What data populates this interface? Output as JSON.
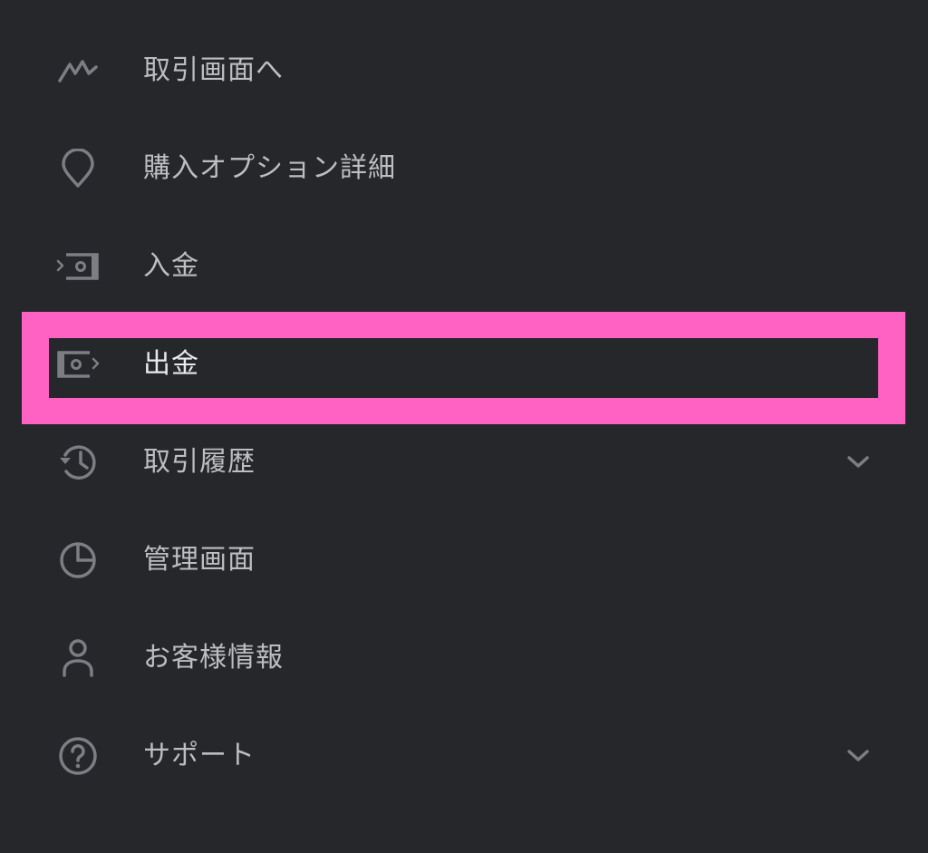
{
  "accent": {
    "highlight_color": "#ff62c2",
    "text_color": "#bdbec2",
    "icon_color": "#7d7e83",
    "background": "#26272b"
  },
  "menu": {
    "items": [
      {
        "label": "取引画面へ",
        "icon": "trade-chart-icon",
        "has_chevron": false
      },
      {
        "label": "購入オプション詳細",
        "icon": "location-pin-icon",
        "has_chevron": false
      },
      {
        "label": "入金",
        "icon": "deposit-icon",
        "has_chevron": false
      },
      {
        "label": "出金",
        "icon": "withdraw-icon",
        "has_chevron": false,
        "highlighted": true
      },
      {
        "label": "取引履歴",
        "icon": "history-icon",
        "has_chevron": true
      },
      {
        "label": "管理画面",
        "icon": "pie-chart-icon",
        "has_chevron": false
      },
      {
        "label": "お客様情報",
        "icon": "person-icon",
        "has_chevron": false
      },
      {
        "label": "サポート",
        "icon": "help-icon",
        "has_chevron": true
      }
    ]
  }
}
